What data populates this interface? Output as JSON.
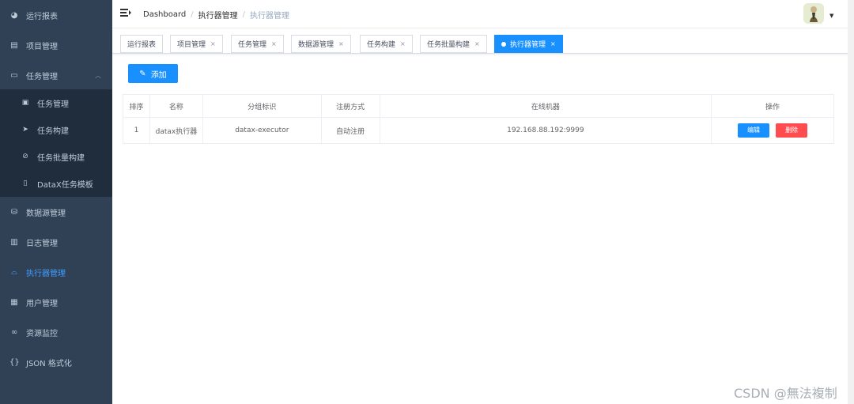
{
  "sidebar": {
    "items": [
      {
        "label": "运行报表",
        "icon": "dashboard-icon"
      },
      {
        "label": "项目管理",
        "icon": "project-icon"
      },
      {
        "label": "任务管理",
        "icon": "monitor-icon"
      },
      {
        "label": "数据源管理",
        "icon": "database-icon"
      },
      {
        "label": "日志管理",
        "icon": "log-icon"
      },
      {
        "label": "执行器管理",
        "icon": "executor-icon"
      },
      {
        "label": "用户管理",
        "icon": "table-icon"
      },
      {
        "label": "资源监控",
        "icon": "link-icon"
      },
      {
        "label": "JSON 格式化",
        "icon": "json-icon"
      }
    ],
    "sub_items": [
      {
        "label": "任务管理",
        "icon": "task-icon"
      },
      {
        "label": "任务构建",
        "icon": "send-icon"
      },
      {
        "label": "任务批量构建",
        "icon": "batch-icon"
      },
      {
        "label": "DataX任务模板",
        "icon": "template-icon"
      }
    ],
    "active_color": "#409eff",
    "background": "#304156"
  },
  "breadcrumb": [
    "Dashboard",
    "执行器管理",
    "执行器管理"
  ],
  "tags": [
    {
      "label": "运行报表"
    },
    {
      "label": "项目管理",
      "close": "×"
    },
    {
      "label": "任务管理",
      "close": "×"
    },
    {
      "label": "数据源管理",
      "close": "×"
    },
    {
      "label": "任务构建",
      "close": "×"
    },
    {
      "label": "任务批量构建",
      "close": "×"
    },
    {
      "label": "执行器管理",
      "close": "×"
    }
  ],
  "toolbar": {
    "add_label": "添加"
  },
  "table": {
    "headers": [
      "排序",
      "名称",
      "分组标识",
      "注册方式",
      "在线机器",
      "操作"
    ],
    "rows": [
      {
        "order": "1",
        "name": "datax执行器",
        "group": "datax-executor",
        "registry": "自动注册",
        "address": "192.168.88.192:9999",
        "edit_label": "编辑",
        "delete_label": "删除"
      }
    ]
  },
  "colors": {
    "primary": "#1890ff",
    "danger": "#ff4d4f"
  },
  "watermark": "CSDN @無法複制"
}
